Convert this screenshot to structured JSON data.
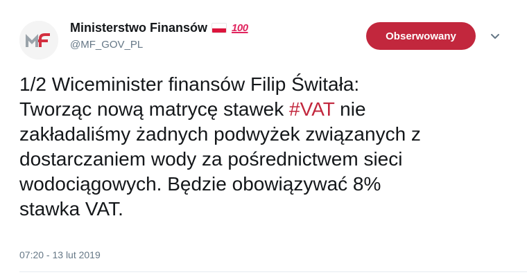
{
  "author": {
    "name": "Ministerstwo Finansów",
    "handle": "@MF_GOV_PL",
    "badge_100": "100",
    "avatar_icon": "mf-logo-icon",
    "flag_icon": "poland-flag-icon"
  },
  "follow_button": {
    "label": "Obserwowany",
    "color": "#c2273d"
  },
  "more_icon": "chevron-down-icon",
  "tweet": {
    "line1": "1/2 Wiceminister finansów Filip Świtała:",
    "line2_before": "Tworząc nową matrycę stawek ",
    "hashtag": "#VAT",
    "line2_after": " nie",
    "line3": "zakładaliśmy żadnych podwyżek związanych z",
    "line4": "dostarczaniem wody za pośrednictwem sieci",
    "line5": "wodociągowych. Będzie obowiązywać 8%",
    "line6": "stawka VAT."
  },
  "timestamp": "07:20 - 13 lut 2019",
  "colors": {
    "hashtag": "#c2273d",
    "secondary_text": "#657786"
  }
}
